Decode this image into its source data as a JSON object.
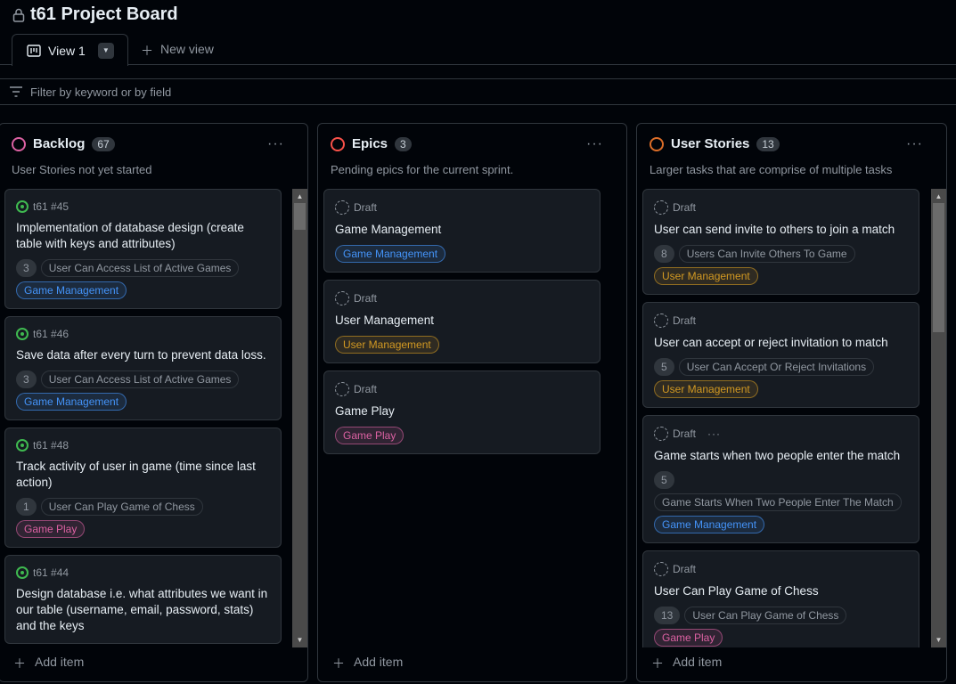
{
  "header": {
    "title": "t61 Project Board",
    "view_tab": "View 1",
    "new_view": "New view",
    "filter_placeholder": "Filter by keyword or by field"
  },
  "colors": {
    "game_management": "#4493f8",
    "user_management": "#d29922",
    "game_play": "#db61a2"
  },
  "columns": [
    {
      "name": "Backlog",
      "count": "67",
      "description": "User Stories not yet started",
      "dot_color": "#db61a2",
      "add_item": "Add item",
      "cards": [
        {
          "ref": "t61 #45",
          "status": "open",
          "title": "Implementation of database design (create table with keys and attributes)",
          "points": "3",
          "parent": "User Can Access List of Active Games",
          "labels": [
            "Game Management"
          ]
        },
        {
          "ref": "t61 #46",
          "status": "open",
          "title": "Save data after every turn to prevent data loss.",
          "points": "3",
          "parent": "User Can Access List of Active Games",
          "labels": [
            "Game Management"
          ]
        },
        {
          "ref": "t61 #48",
          "status": "open",
          "title": "Track activity of user in game (time since last action)",
          "points": "1",
          "parent": "User Can Play Game of Chess",
          "labels": [
            "Game Play"
          ]
        },
        {
          "ref": "t61 #44",
          "status": "open",
          "title": "Design database i.e. what attributes we want in our table (username, email, password, stats) and the keys",
          "points": "",
          "parent": "",
          "labels": []
        }
      ]
    },
    {
      "name": "Epics",
      "count": "3",
      "description": "Pending epics for the current sprint.",
      "dot_color": "#f85149",
      "add_item": "Add item",
      "cards": [
        {
          "ref": "Draft",
          "status": "draft",
          "title": "Game Management",
          "points": "",
          "parent": "",
          "labels": [
            "Game Management"
          ]
        },
        {
          "ref": "Draft",
          "status": "draft",
          "title": "User Management",
          "points": "",
          "parent": "",
          "labels": [
            "User Management"
          ]
        },
        {
          "ref": "Draft",
          "status": "draft",
          "title": "Game Play",
          "points": "",
          "parent": "",
          "labels": [
            "Game Play"
          ]
        }
      ]
    },
    {
      "name": "User Stories",
      "count": "13",
      "description": "Larger tasks that are comprise of multiple tasks",
      "dot_color": "#db6d28",
      "add_item": "Add item",
      "cards": [
        {
          "ref": "Draft",
          "status": "draft",
          "title": "User can send invite to others to join a match",
          "points": "8",
          "parent": "Users Can Invite Others To Game",
          "labels": [
            "User Management"
          ]
        },
        {
          "ref": "Draft",
          "status": "draft",
          "title": "User can accept or reject invitation to match",
          "points": "5",
          "parent": "User Can Accept Or Reject Invitations",
          "labels": [
            "User Management"
          ]
        },
        {
          "ref": "Draft",
          "status": "draft",
          "title": "Game starts when two people enter the match",
          "points": "5",
          "parent": "Game Starts When Two People Enter The Match",
          "labels": [
            "Game Management"
          ],
          "hover_menu": true
        },
        {
          "ref": "Draft",
          "status": "draft",
          "title": "User Can Play Game of Chess",
          "points": "13",
          "parent": "User Can Play Game of Chess",
          "labels": [
            "Game Play"
          ]
        }
      ]
    }
  ]
}
